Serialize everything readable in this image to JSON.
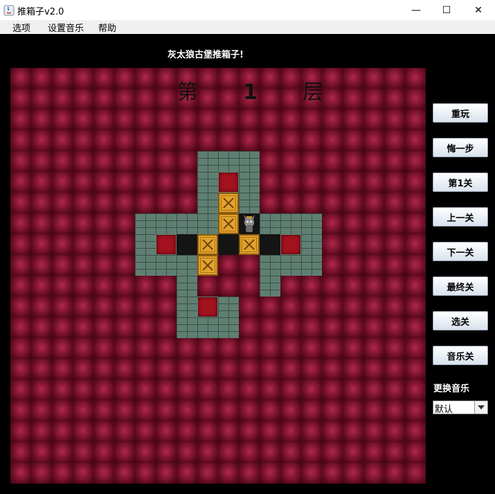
{
  "window": {
    "title": "推箱子v2.0",
    "minimize_glyph": "—",
    "maximize_glyph": "☐",
    "close_glyph": "✕"
  },
  "menu": [
    "选项",
    "设置音乐",
    "帮助"
  ],
  "game": {
    "title": "灰太狼古堡推箱子!",
    "level_prefix": "第",
    "level_number": "1",
    "level_suffix": "层",
    "map": [
      "   ###   ",
      "   #.#   ",
      "   #$#   ",
      "####$@###",
      "#._$_$_.#",
      "###$  ###",
      "  #   #  ",
      "  #.#    ",
      "  ###    "
    ]
  },
  "buttons": [
    "重玩",
    "悔一步",
    "第1关",
    "上一关",
    "下一关",
    "最终关",
    "选关",
    "音乐关"
  ],
  "music": {
    "label": "更换音乐",
    "selected": "默认"
  },
  "colors": {
    "background": "#000000",
    "board": "#6d0d22",
    "wall": "#5f7f72",
    "goal": "#a3121f",
    "box": "#e2a22a"
  }
}
